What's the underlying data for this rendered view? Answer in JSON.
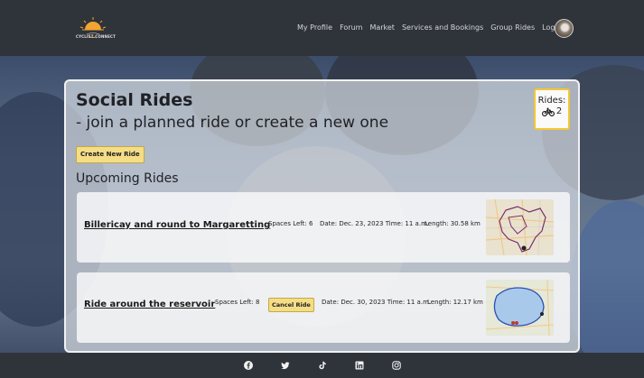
{
  "brand": {
    "name": "CYCLIST CONNECT"
  },
  "nav": {
    "items": [
      {
        "label": "My Profile"
      },
      {
        "label": "Forum"
      },
      {
        "label": "Market"
      },
      {
        "label": "Services and Bookings"
      },
      {
        "label": "Group Rides"
      },
      {
        "label": "Logout"
      }
    ]
  },
  "page": {
    "title": "Social Rides",
    "subtitle": "- join a planned ride or create a new one",
    "rides_counter": {
      "label": "Rides:",
      "count": "2",
      "icon": "bicycle-icon"
    },
    "create_button": "Create New Ride",
    "section_title": "Upcoming Rides"
  },
  "rides": [
    {
      "name": "Billericay and round to Margaretting",
      "spaces": "Spaces Left: 6",
      "date": "Date: Dec. 23, 2023 Time: 11 a.m.",
      "length": "Length: 30.58 km",
      "map_icon": "route-map-icon"
    },
    {
      "name": "Ride around the reservoir",
      "spaces": "Spaces Left: 8",
      "cancel_button": "Cancel Ride",
      "date": "Date: Dec. 30, 2023 Time: 11 a.m.",
      "length": "Length: 12.17 km",
      "map_icon": "route-map-icon"
    }
  ],
  "footer": {
    "social_icons": [
      "facebook-icon",
      "twitter-icon",
      "tiktok-icon",
      "linkedin-icon",
      "instagram-icon"
    ]
  },
  "colors": {
    "navbar": "#2f333a",
    "accent_button": "#f4dd86",
    "counter_border": "#f2c832"
  }
}
